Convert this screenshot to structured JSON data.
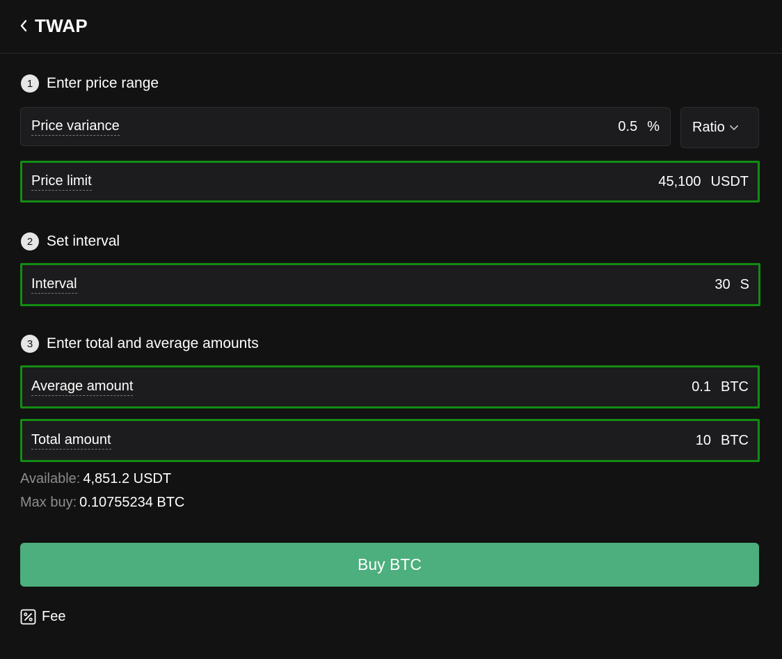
{
  "header": {
    "title": "TWAP"
  },
  "sections": [
    {
      "number": "1",
      "label": "Enter price range"
    },
    {
      "number": "2",
      "label": "Set interval"
    },
    {
      "number": "3",
      "label": "Enter total and average amounts"
    }
  ],
  "fields": {
    "price_variance": {
      "label": "Price variance",
      "value": "0.5",
      "unit": "%"
    },
    "price_limit": {
      "label": "Price limit",
      "value": "45,100",
      "unit": "USDT"
    },
    "interval": {
      "label": "Interval",
      "value": "30",
      "unit": "S"
    },
    "average_amount": {
      "label": "Average amount",
      "value": "0.1",
      "unit": "BTC"
    },
    "total_amount": {
      "label": "Total amount",
      "value": "10",
      "unit": "BTC"
    }
  },
  "ratio_select": {
    "selected": "Ratio"
  },
  "available": {
    "label": "Available:",
    "value": "4,851.2 USDT"
  },
  "max_buy": {
    "label": "Max buy:",
    "value": "0.10755234 BTC"
  },
  "buy_button": {
    "label": "Buy BTC"
  },
  "fee": {
    "label": "Fee"
  },
  "colors": {
    "background": "#121212",
    "field_bg": "#1c1c1e",
    "highlight_border": "#138c13",
    "buy_green": "#4caf7d",
    "muted_text": "#8c8c8c"
  }
}
